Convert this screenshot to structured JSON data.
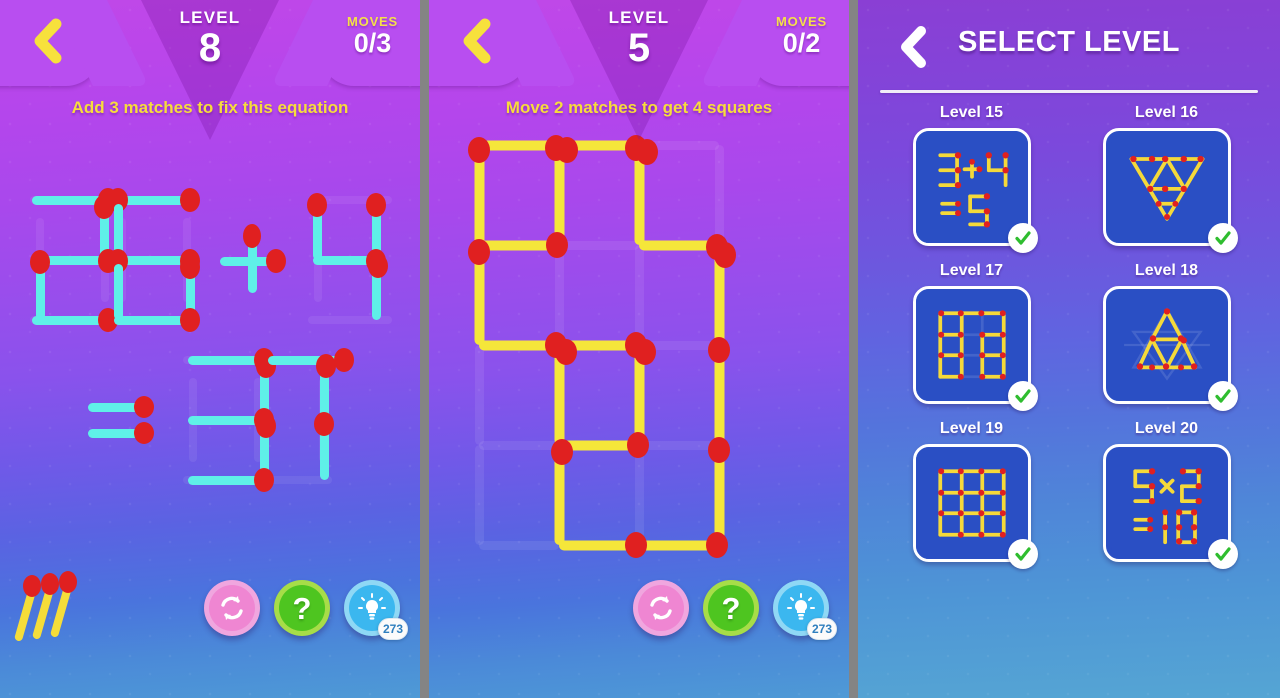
{
  "panels": {
    "game1": {
      "level_word": "LEVEL",
      "level_number": "8",
      "moves_word": "MOVES",
      "moves_value": "0/3",
      "hint": "Add 3 matches to fix this equation",
      "back_icon": "back-chevron-icon",
      "equation_display": "26 + 4 = 37",
      "match_color": "#5ff0e8",
      "head_color": "#e02020",
      "buttons": {
        "restart_label": "restart-icon",
        "help_label": "?",
        "hint_label": "lightbulb-icon",
        "hint_count": "273"
      },
      "matchstack_count": 3
    },
    "game2": {
      "level_word": "LEVEL",
      "level_number": "5",
      "moves_word": "MOVES",
      "moves_value": "0/2",
      "hint": "Move 2 matches to get 4 squares",
      "back_icon": "back-chevron-icon",
      "match_color": "#f5e63a",
      "head_color": "#e02020",
      "buttons": {
        "restart_label": "restart-icon",
        "help_label": "?",
        "hint_label": "lightbulb-icon",
        "hint_count": "273"
      }
    },
    "levels": {
      "title": "SELECT LEVEL",
      "back_icon": "back-chevron-icon",
      "items": [
        {
          "label": "Level 15",
          "puzzle": "3 + 4 = 5",
          "completed": true
        },
        {
          "label": "Level 16",
          "puzzle": "inverted-triangles",
          "completed": true
        },
        {
          "label": "Level 17",
          "puzzle": "square-grid-partial",
          "completed": true
        },
        {
          "label": "Level 18",
          "puzzle": "triangle-stack",
          "completed": true
        },
        {
          "label": "Level 19",
          "puzzle": "square-grid-3x3",
          "completed": true
        },
        {
          "label": "Level 20",
          "puzzle": "5 x 2 = 10",
          "completed": true
        }
      ],
      "check_color": "#2fbd2f",
      "card_color": "#2a4fc4",
      "match_color": "#f5d93a"
    }
  }
}
